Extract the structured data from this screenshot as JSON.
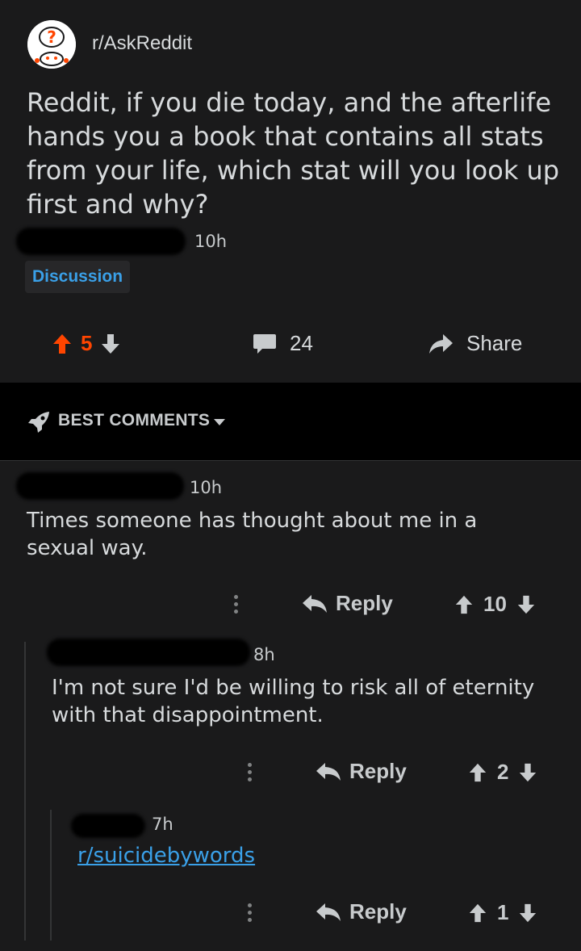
{
  "post": {
    "subreddit": "r/AskReddit",
    "title": "Reddit, if you die today, and the afterlife hands you a book that contains all stats from your life, which stat will you look up first and why?",
    "time": "10h",
    "flair": "Discussion",
    "score": "5",
    "comments": "24",
    "share": "Share",
    "upvote_color": "#ff4500"
  },
  "sort": {
    "label": "BEST COMMENTS"
  },
  "comments": [
    {
      "time": "10h",
      "text": "Times someone has thought about me in a sexual way.",
      "reply": "Reply",
      "score": "10"
    },
    {
      "time": "8h",
      "text": "I'm not sure I'd be willing to risk all of eternity with that disappointment.",
      "reply": "Reply",
      "score": "2"
    },
    {
      "time": "7h",
      "text": "r/suicidebywords",
      "reply": "Reply",
      "score": "1"
    }
  ]
}
